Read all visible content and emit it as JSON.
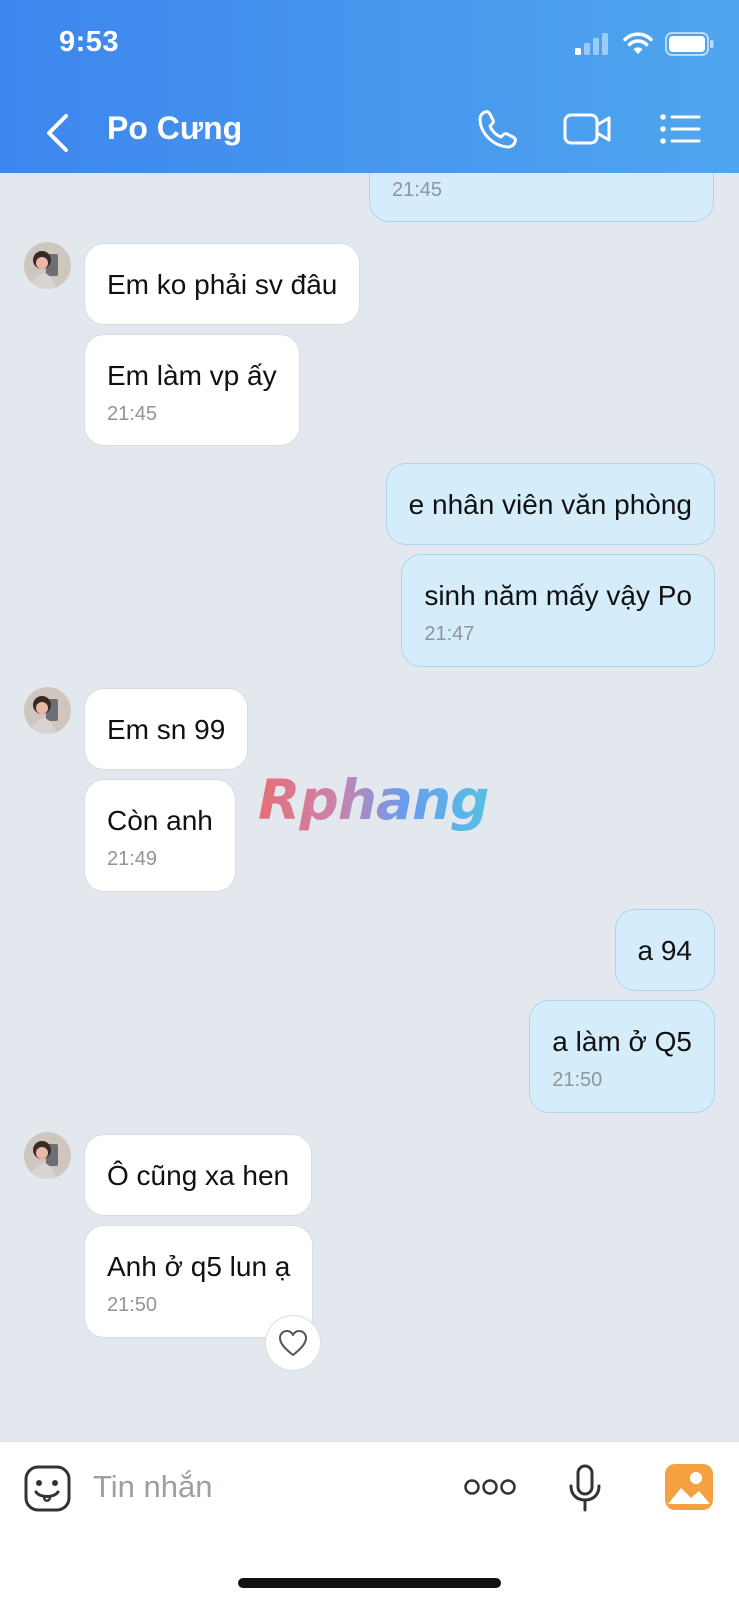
{
  "status_bar": {
    "time": "9:53"
  },
  "header": {
    "title": "Po Cưng"
  },
  "messages": [
    {
      "time": "21:45"
    },
    {
      "text": "Em ko phải sv đâu"
    },
    {
      "text": "Em làm vp ấy",
      "time": "21:45"
    },
    {
      "text": "e nhân viên văn phòng"
    },
    {
      "text": "sinh năm mấy vậy Po",
      "time": "21:47"
    },
    {
      "text": "Em sn 99"
    },
    {
      "text": "Còn anh",
      "time": "21:49"
    },
    {
      "text": "a 94"
    },
    {
      "text": "a làm ở Q5",
      "time": "21:50"
    },
    {
      "text": "Ô cũng xa hen"
    },
    {
      "text": "Anh ở q5 lun ạ",
      "time": "21:50"
    }
  ],
  "watermark": "Rphang",
  "composer": {
    "placeholder": "Tin nhắn"
  },
  "icons": {
    "status": [
      "signal-icon",
      "wifi-icon",
      "battery-icon"
    ],
    "header": [
      "back-icon",
      "phone-icon",
      "video-call-icon",
      "menu-list-icon"
    ],
    "composer": [
      "sticker-icon",
      "more-icon",
      "microphone-icon",
      "image-icon"
    ],
    "reaction": "heart-icon"
  },
  "colors": {
    "header_start": "#3d86ee",
    "header_end": "#4fa6ee",
    "outgoing_bubble": "#d5ecfb",
    "incoming_bubble": "#ffffff",
    "background": "#e3e8ef"
  }
}
